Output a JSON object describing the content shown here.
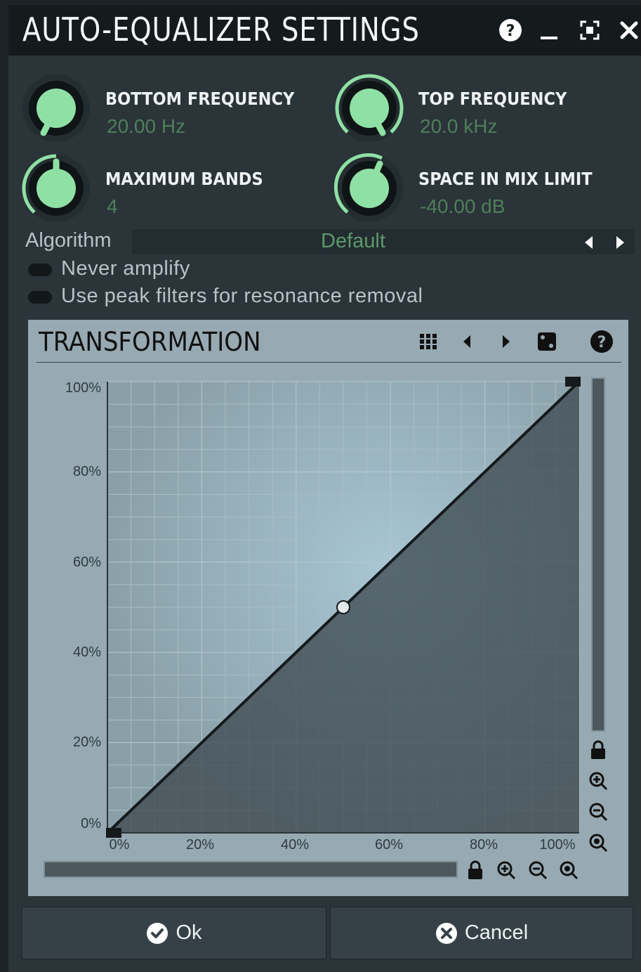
{
  "window": {
    "title": "AUTO-EQUALIZER SETTINGS",
    "buttons": [
      "help-icon",
      "minimize-icon",
      "fullscreen-icon",
      "close-icon"
    ]
  },
  "knobs": [
    {
      "label": "BOTTOM FREQUENCY",
      "value": "20.00 Hz",
      "fraction": 0.0
    },
    {
      "label": "TOP FREQUENCY",
      "value": "20.0 kHz",
      "fraction": 1.0
    },
    {
      "label": "MAXIMUM BANDS",
      "value": "4",
      "fraction": 0.5
    },
    {
      "label": "SPACE IN MIX LIMIT",
      "value": "-40.00 dB",
      "fraction": 0.6
    }
  ],
  "algorithm": {
    "label": "Algorithm",
    "value": "Default"
  },
  "toggles": [
    {
      "label": "Never amplify",
      "on": false
    },
    {
      "label": "Use peak filters for resonance removal",
      "on": false
    }
  ],
  "transformation": {
    "title": "TRANSFORMATION",
    "toolbar": [
      "grid-icon",
      "arrow-left-icon",
      "arrow-right-icon",
      "dice-icon",
      "help-icon"
    ],
    "y_ticks": [
      "100%",
      "80%",
      "60%",
      "40%",
      "20%",
      "0%"
    ],
    "x_ticks": [
      "0%",
      "20%",
      "40%",
      "60%",
      "80%",
      "100%"
    ]
  },
  "chart_data": {
    "type": "line",
    "x": [
      0,
      50,
      100
    ],
    "y": [
      0,
      50,
      100
    ],
    "xlim": [
      0,
      100
    ],
    "ylim": [
      0,
      100
    ],
    "grid": true
  },
  "colors": {
    "accent_green": "#8fe0a4",
    "value_green": "#4f7f5a",
    "panel": "#2a3439",
    "graph_bg": "#97aab3"
  },
  "footer": {
    "ok_label": "Ok",
    "cancel_label": "Cancel"
  }
}
